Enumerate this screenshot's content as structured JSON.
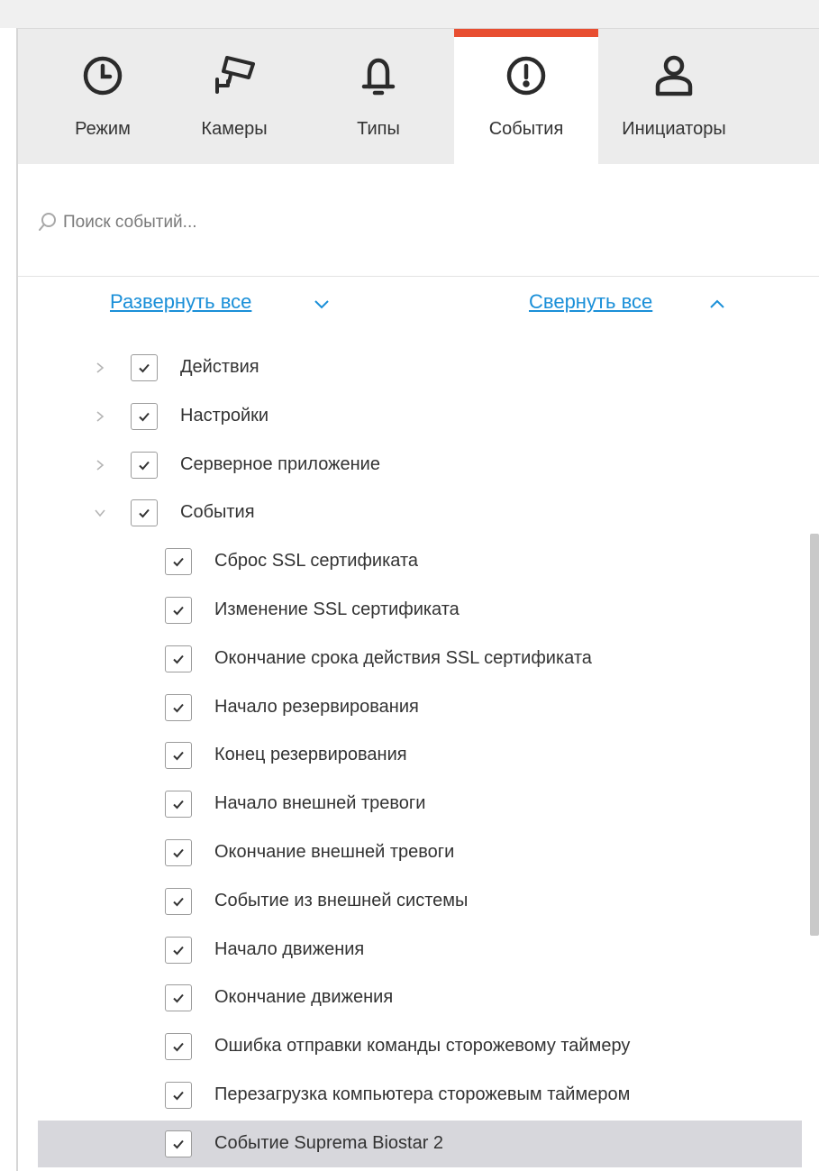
{
  "tabs": [
    {
      "label": "Режим",
      "icon": "clock-icon"
    },
    {
      "label": "Камеры",
      "icon": "camera-icon"
    },
    {
      "label": "Типы",
      "icon": "bell-icon"
    },
    {
      "label": "События",
      "icon": "alert-circle-icon",
      "active": true
    },
    {
      "label": "Инициаторы",
      "icon": "user-icon"
    }
  ],
  "search": {
    "placeholder": "Поиск событий..."
  },
  "controls": {
    "expand_all": "Развернуть все",
    "collapse_all": "Свернуть все"
  },
  "tree": {
    "groups": [
      {
        "label": "Действия",
        "checked": true,
        "expanded": false
      },
      {
        "label": "Настройки",
        "checked": true,
        "expanded": false
      },
      {
        "label": "Серверное приложение",
        "checked": true,
        "expanded": false
      },
      {
        "label": "События",
        "checked": true,
        "expanded": true
      }
    ],
    "events": [
      {
        "label": "Сброс SSL сертификата",
        "checked": true
      },
      {
        "label": "Изменение SSL сертификата",
        "checked": true
      },
      {
        "label": "Окончание срока действия SSL сертификата",
        "checked": true
      },
      {
        "label": "Начало резервирования",
        "checked": true
      },
      {
        "label": "Конец резервирования",
        "checked": true
      },
      {
        "label": "Начало внешней тревоги",
        "checked": true
      },
      {
        "label": "Окончание внешней тревоги",
        "checked": true
      },
      {
        "label": "Событие из внешней системы",
        "checked": true
      },
      {
        "label": "Начало движения",
        "checked": true
      },
      {
        "label": "Окончание движения",
        "checked": true
      },
      {
        "label": "Ошибка отправки команды сторожевому таймеру",
        "checked": true
      },
      {
        "label": "Перезагрузка компьютера сторожевым таймером",
        "checked": true
      },
      {
        "label": "Событие Suprema Biostar 2",
        "checked": true,
        "selected": true
      }
    ]
  },
  "colors": {
    "accent_tab": "#e84e31",
    "link": "#1a8fd8",
    "selected_row": "#d7d7dc",
    "tabbar_bg": "#ececec"
  }
}
